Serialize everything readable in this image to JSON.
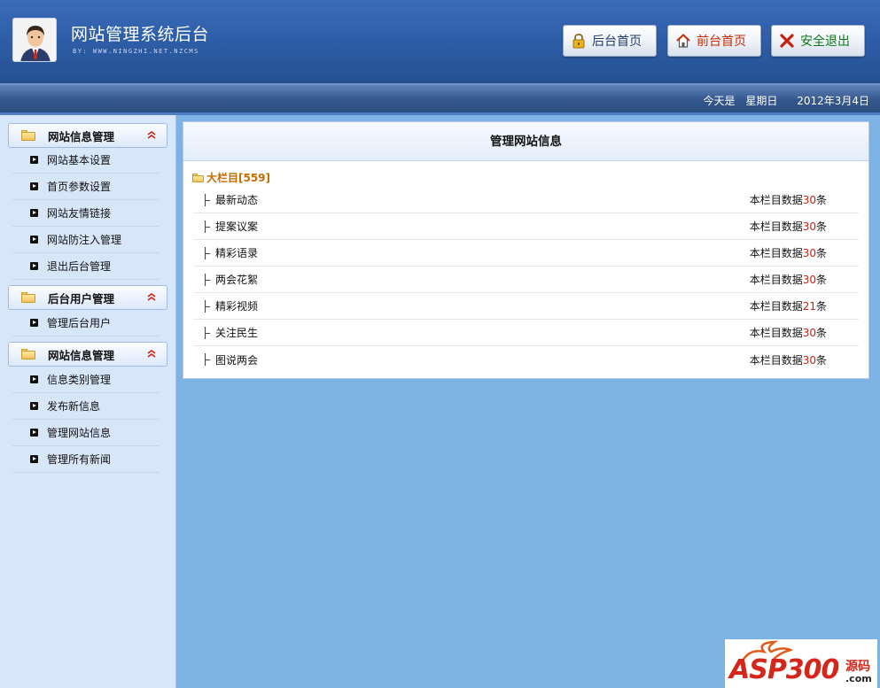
{
  "header": {
    "title": "网站管理系统后台",
    "subtitle": "BY: WWW.NINGZHI.NET.NZCMS",
    "buttons": {
      "admin_home": "后台首页",
      "front_home": "前台首页",
      "logout": "安全退出"
    }
  },
  "infobar": {
    "today_label": "今天是",
    "weekday": "星期日",
    "date": "2012年3月4日"
  },
  "sidebar": {
    "groups": [
      {
        "title": "网站信息管理",
        "items": [
          "网站基本设置",
          "首页参数设置",
          "网站友情链接",
          "网站防注入管理",
          "退出后台管理"
        ]
      },
      {
        "title": "后台用户管理",
        "items": [
          "管理后台用户"
        ]
      },
      {
        "title": "网站信息管理",
        "items": [
          "信息类别管理",
          "发布新信息",
          "管理网站信息",
          "管理所有新闻"
        ]
      }
    ],
    "collapse_glyph": "⌃"
  },
  "main": {
    "title": "管理网站信息",
    "category": "大栏目[559]",
    "count_prefix": "本栏目数据",
    "count_suffix": "条",
    "rows": [
      {
        "name": "最新动态",
        "count": "30"
      },
      {
        "name": "提案议案",
        "count": "30"
      },
      {
        "name": "精彩语录",
        "count": "30"
      },
      {
        "name": "两会花絮",
        "count": "30"
      },
      {
        "name": "精彩视频",
        "count": "21"
      },
      {
        "name": "关注民生",
        "count": "30"
      },
      {
        "name": "图说两会",
        "count": "30"
      }
    ]
  },
  "watermark": {
    "brand": "ASP300",
    "side": "源码",
    "domain": ".com"
  },
  "colors": {
    "header_blue": "#2f5ea9",
    "sidebar_bg": "#d8e6f9",
    "content_bg": "#7db3e4",
    "accent_red": "#d0200a",
    "category_orange": "#c66c00"
  }
}
